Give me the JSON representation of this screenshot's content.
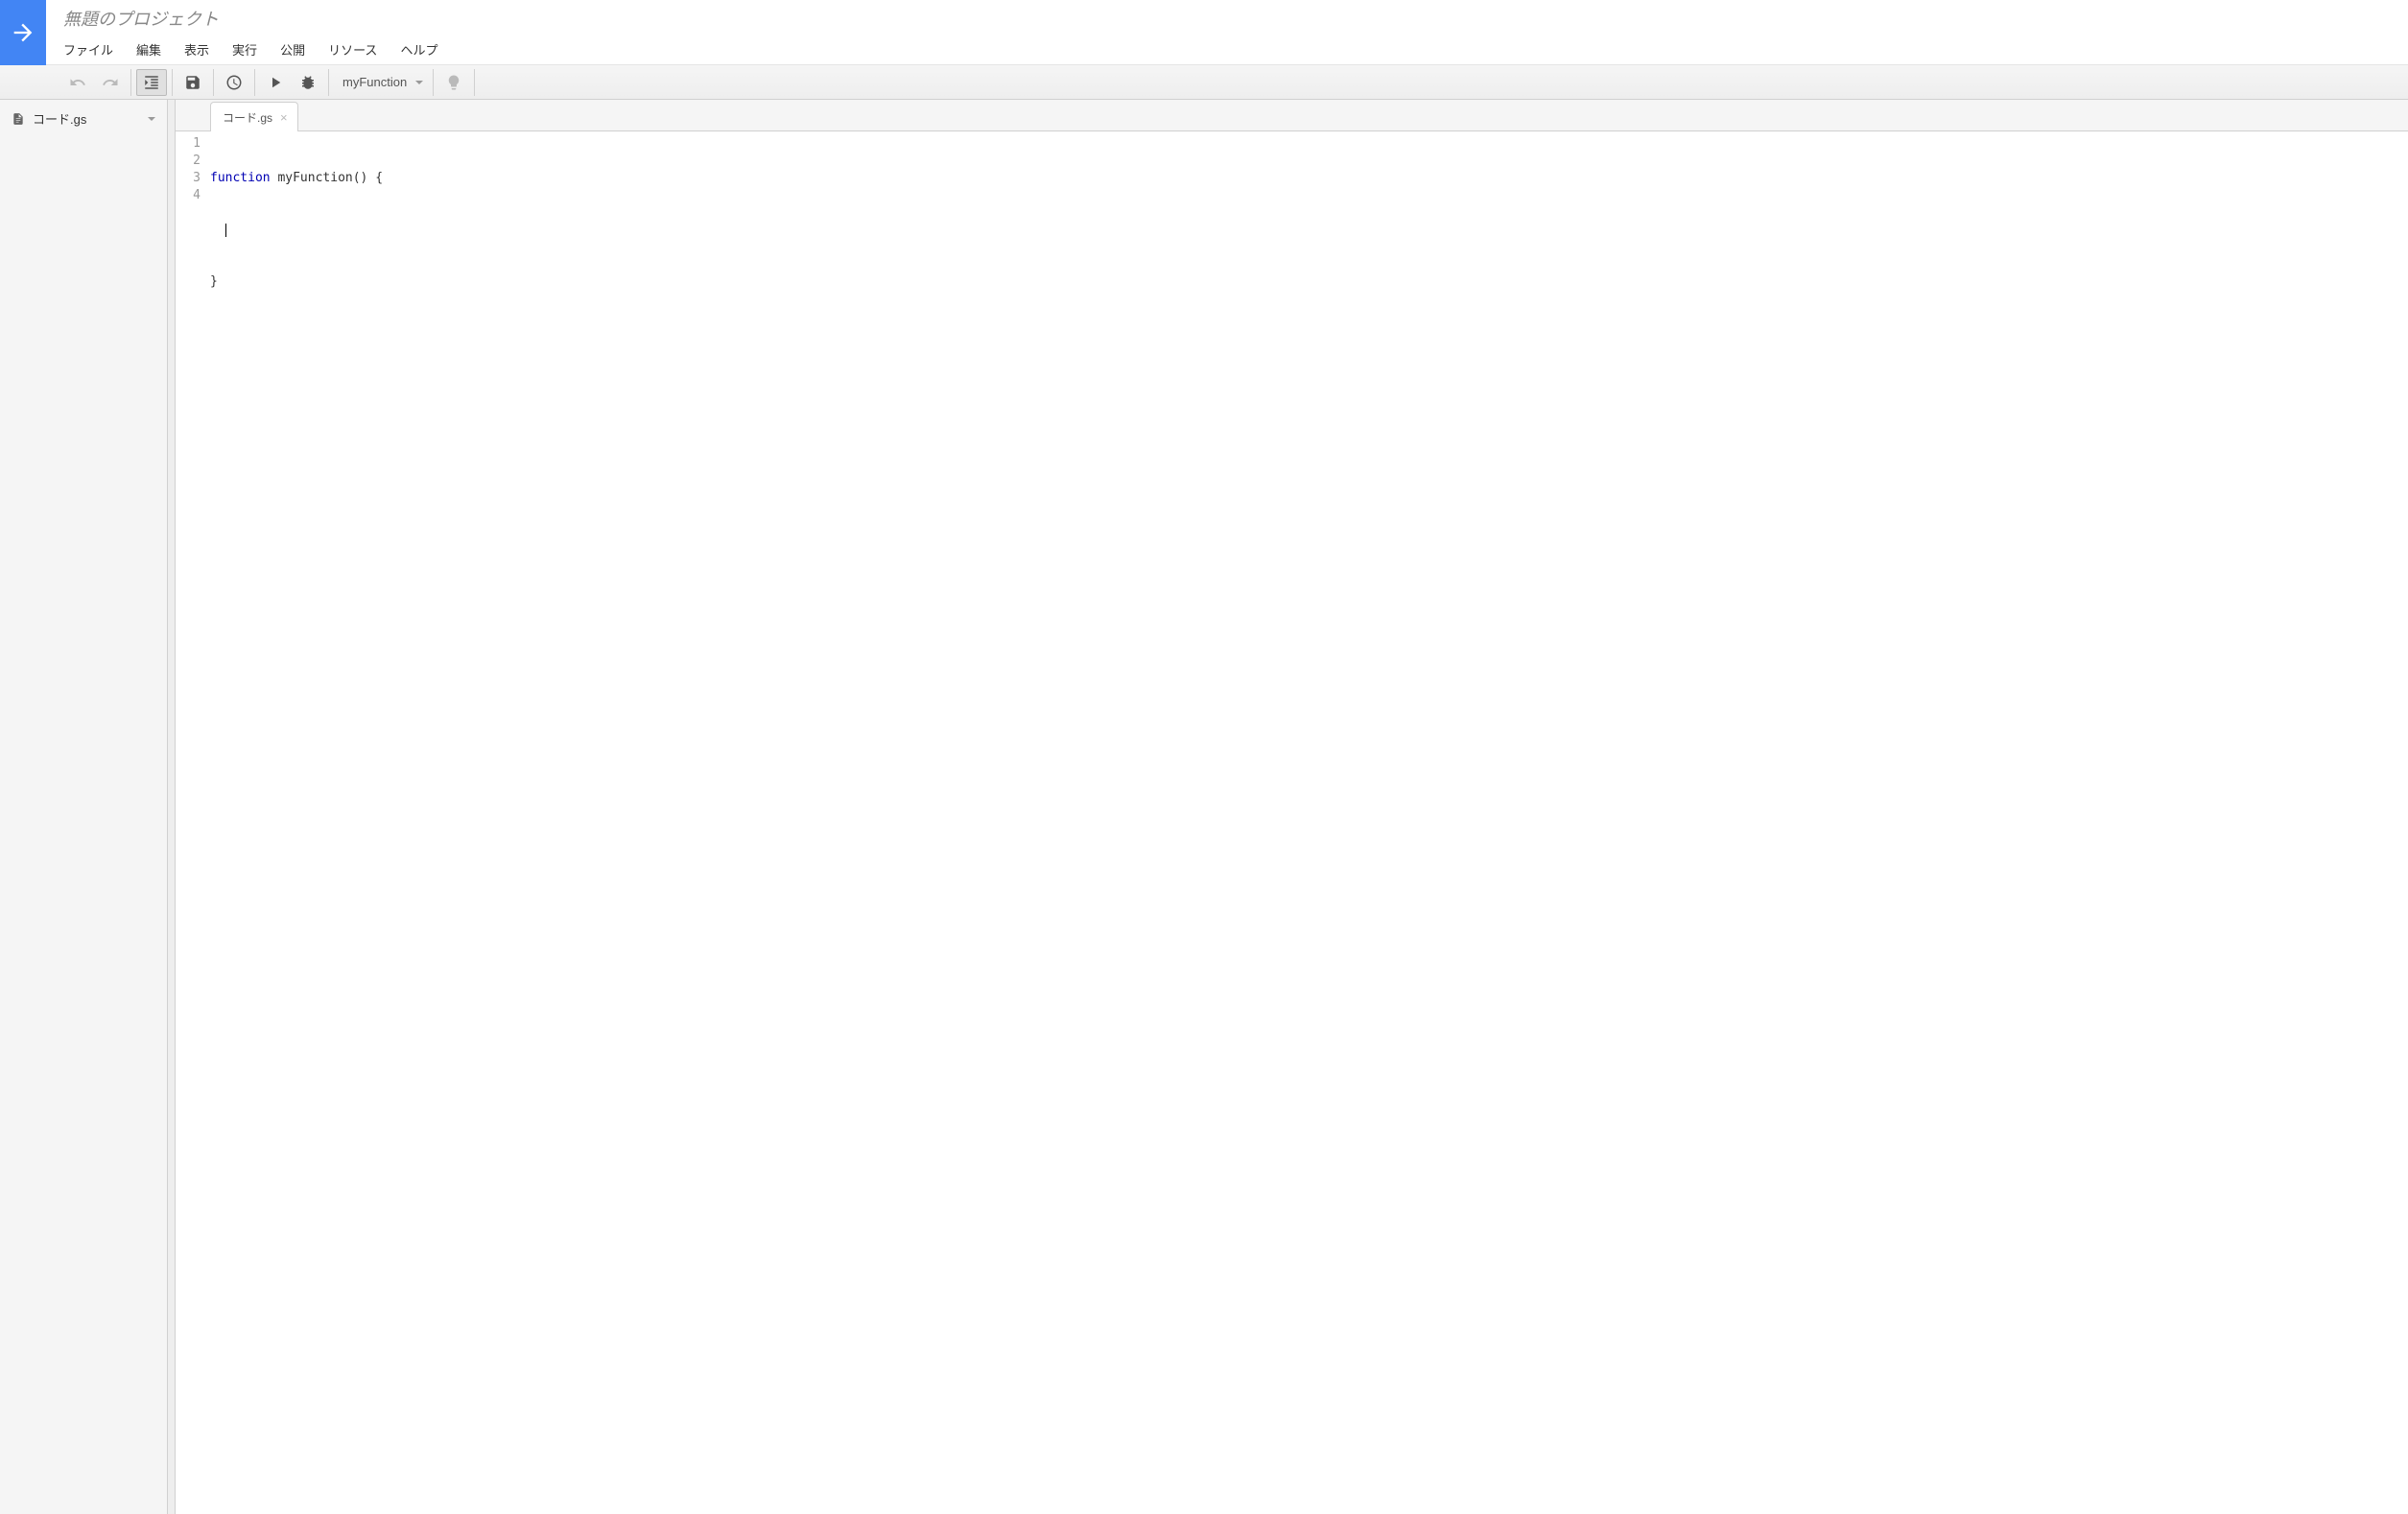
{
  "header": {
    "project_title": "無題のプロジェクト",
    "menus": {
      "file": "ファイル",
      "edit": "編集",
      "view": "表示",
      "run": "実行",
      "publish": "公開",
      "resources": "リソース",
      "help": "ヘルプ"
    }
  },
  "toolbar": {
    "selected_function": "myFunction"
  },
  "sidebar": {
    "file_name": "コード.gs"
  },
  "editor": {
    "tab_name": "コード.gs",
    "lines": {
      "l1_kw": "function",
      "l1_rest": " myFunction() {",
      "l2": "  ",
      "l3": "}",
      "l4": ""
    },
    "line_numbers": [
      "1",
      "2",
      "3",
      "4"
    ]
  }
}
